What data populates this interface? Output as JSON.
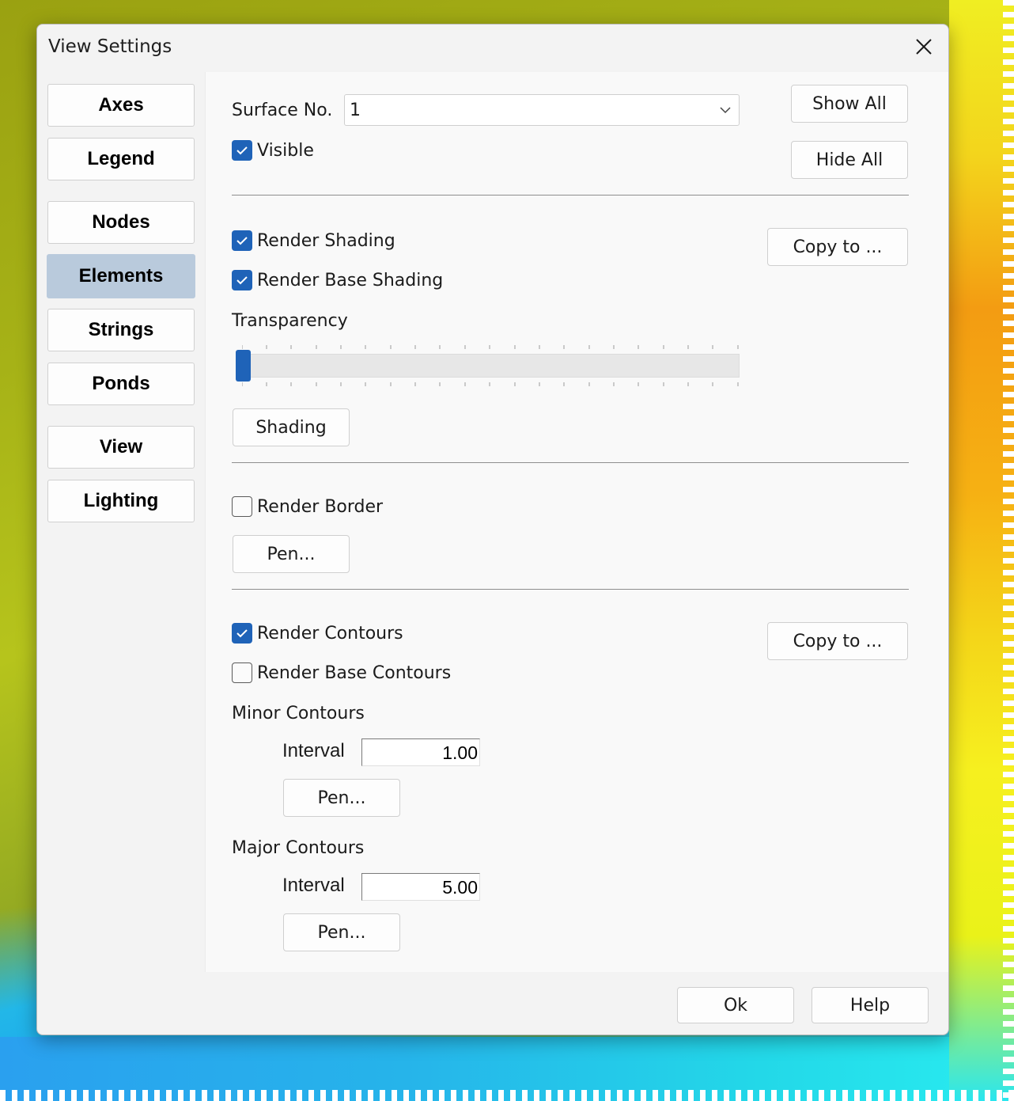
{
  "window": {
    "title": "View Settings"
  },
  "nav": {
    "items": [
      {
        "label": "Axes"
      },
      {
        "label": "Legend"
      },
      {
        "label": "Nodes"
      },
      {
        "label": "Elements",
        "active": true
      },
      {
        "label": "Strings"
      },
      {
        "label": "Ponds"
      },
      {
        "label": "View"
      },
      {
        "label": "Lighting"
      }
    ]
  },
  "surface": {
    "label": "Surface No.",
    "value": "1",
    "visible_label": "Visible",
    "visible": true,
    "show_all": "Show All",
    "hide_all": "Hide All"
  },
  "shading": {
    "render_shading_label": "Render Shading",
    "render_shading": true,
    "render_base_shading_label": "Render Base Shading",
    "render_base_shading": true,
    "copy_to": "Copy to ...",
    "transparency_label": "Transparency",
    "transparency_value": 0,
    "shading_button": "Shading"
  },
  "border": {
    "render_border_label": "Render Border",
    "render_border": false,
    "pen_button": "Pen..."
  },
  "contours": {
    "render_contours_label": "Render Contours",
    "render_contours": true,
    "render_base_contours_label": "Render Base Contours",
    "render_base_contours": false,
    "copy_to": "Copy to ...",
    "minor_label": "Minor Contours",
    "minor_interval_label": "Interval",
    "minor_interval": "1.00",
    "minor_pen": "Pen...",
    "major_label": "Major Contours",
    "major_interval_label": "Interval",
    "major_interval": "5.00",
    "major_pen": "Pen..."
  },
  "footer": {
    "ok": "Ok",
    "help": "Help"
  },
  "colors": {
    "accent": "#1f63b8",
    "nav_active": "#b9cadc"
  }
}
